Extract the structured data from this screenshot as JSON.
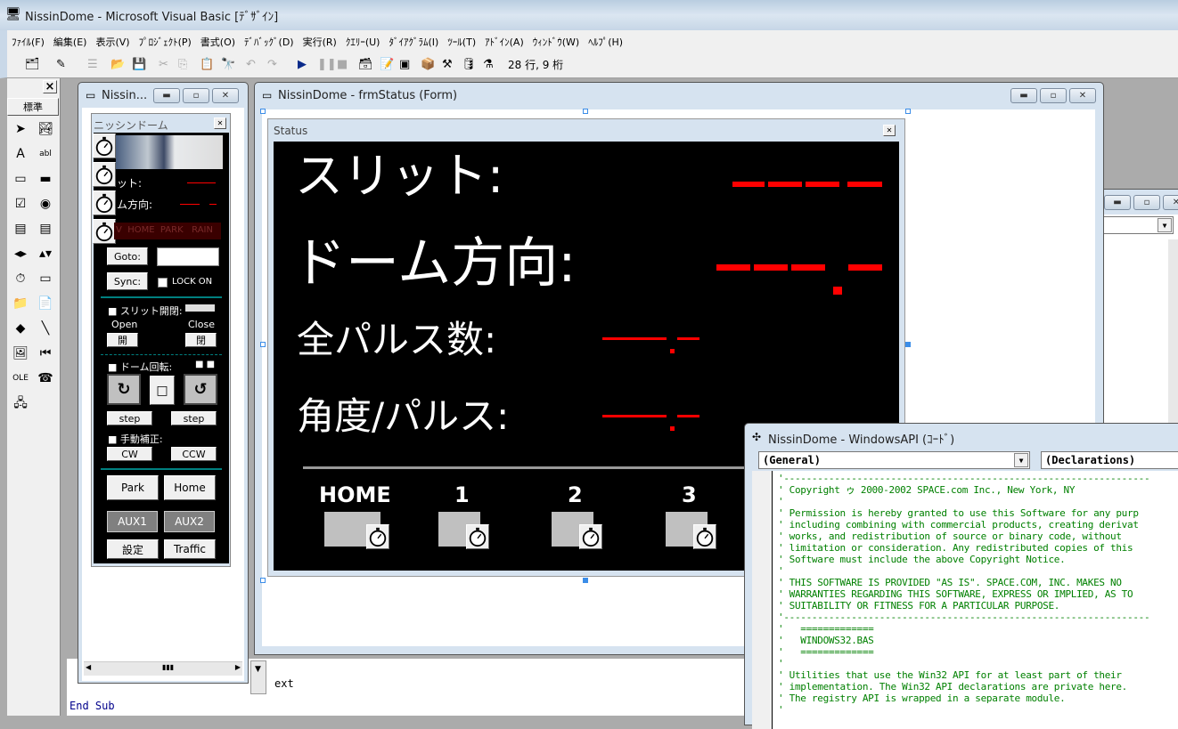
{
  "app": {
    "title": "NissinDome - Microsoft Visual Basic [ﾃﾞｻﾞｲﾝ]"
  },
  "menu": [
    "ﾌｧｲﾙ(F)",
    "編集(E)",
    "表示(V)",
    "ﾌﾟﾛｼﾞｪｸﾄ(P)",
    "書式(O)",
    "ﾃﾞﾊﾞｯｸﾞ(D)",
    "実行(R)",
    "ｸｴﾘｰ(U)",
    "ﾀﾞｲｱｸﾞﾗﾑ(I)",
    "ﾂｰﾙ(T)",
    "ｱﾄﾞｲﾝ(A)",
    "ｳｨﾝﾄﾞｳ(W)",
    "ﾍﾙﾌﾟ(H)"
  ],
  "toolbar": {
    "icons": [
      "add-project-icon",
      "add-form-icon",
      "menu-editor-icon",
      "open-icon",
      "save-icon",
      "cut-icon",
      "copy-icon",
      "paste-icon",
      "find-icon",
      "undo-icon",
      "redo-icon",
      "run-icon",
      "pause-icon",
      "stop-icon",
      "project-explorer-icon",
      "properties-icon",
      "form-layout-icon",
      "object-browser-icon",
      "toolbox-icon",
      "data-view-icon",
      "component-manager-icon"
    ],
    "position": "28 行, 9 桁"
  },
  "toolbox": {
    "tab": "標準",
    "close": "×",
    "items": [
      "pointer",
      "picturebox",
      "label",
      "textbox",
      "frame",
      "commandbutton",
      "checkbox",
      "optionbutton",
      "combobox",
      "listbox",
      "hscrollbar",
      "vscrollbar",
      "timer",
      "drivelistbox",
      "dirlistbox",
      "filelistbox",
      "shape",
      "line",
      "image",
      "data",
      "ole",
      "dbgrid",
      "extra"
    ]
  },
  "project_window": {
    "title": "Nissin...",
    "form": {
      "title": "ニッシンドーム",
      "slit_label": "ット:",
      "dome_label": "ム方向:",
      "indicators": "V  HOME  PARK   RAIN",
      "goto": "Goto:",
      "sync": "Sync:",
      "lock_on": "LOCK ON",
      "slit_open_close": "■  スリット開閉:",
      "open_label": "Open",
      "close_label": "Close",
      "open_btn": "開",
      "close_btn": "閉",
      "dome_rotate": "■  ドーム回転:",
      "dome_marks": "■ ■",
      "ccw_rot": "↻",
      "stop": "□",
      "cw_rot": "↺",
      "step": "step",
      "manual": "■  手動補正:",
      "cw": "CW",
      "ccw": "CCW",
      "park": "Park",
      "home": "Home",
      "aux1": "AUX1",
      "aux2": "AUX2",
      "settings": "設定",
      "traffic": "Traffic"
    }
  },
  "status_window": {
    "title": "NissinDome - frmStatus (Form)",
    "form": {
      "title": "Status",
      "slit": "スリット:",
      "dome": "ドーム方向:",
      "pulses": "全パルス数:",
      "angle": "角度/パルス:",
      "positions": [
        "HOME",
        "1",
        "2",
        "3"
      ]
    }
  },
  "code_bg": {
    "ext": "ext",
    "end_sub": "End Sub"
  },
  "code_window": {
    "title": "NissinDome - WindowsAPI (ｺｰﾄﾞ)",
    "object": "(General)",
    "procedure": "(Declarations)",
    "lines": [
      "'-----------------------------------------------------------------",
      "' Copyright ゥ 2000-2002 SPACE.com Inc., New York, NY",
      "'",
      "' Permission is hereby granted to use this Software for any purp",
      "' including combining with commercial products, creating derivat",
      "' works, and redistribution of source or binary code, without",
      "' limitation or consideration. Any redistributed copies of this",
      "' Software must include the above Copyright Notice.",
      "'",
      "' THIS SOFTWARE IS PROVIDED \"AS IS\". SPACE.COM, INC. MAKES NO",
      "' WARRANTIES REGARDING THIS SOFTWARE, EXPRESS OR IMPLIED, AS TO",
      "' SUITABILITY OR FITNESS FOR A PARTICULAR PURPOSE.",
      "'-----------------------------------------------------------------",
      "'   =============",
      "'   WINDOWS32.BAS",
      "'   =============",
      "'",
      "' Utilities that use the Win32 API for at least part of their",
      "' implementation. The Win32 API declarations are private here.",
      "' The registry API is wrapped in a separate module.",
      "'"
    ]
  },
  "colors": {
    "led_red": "#ff0000",
    "code_green": "#008000",
    "teal": "#008080"
  }
}
